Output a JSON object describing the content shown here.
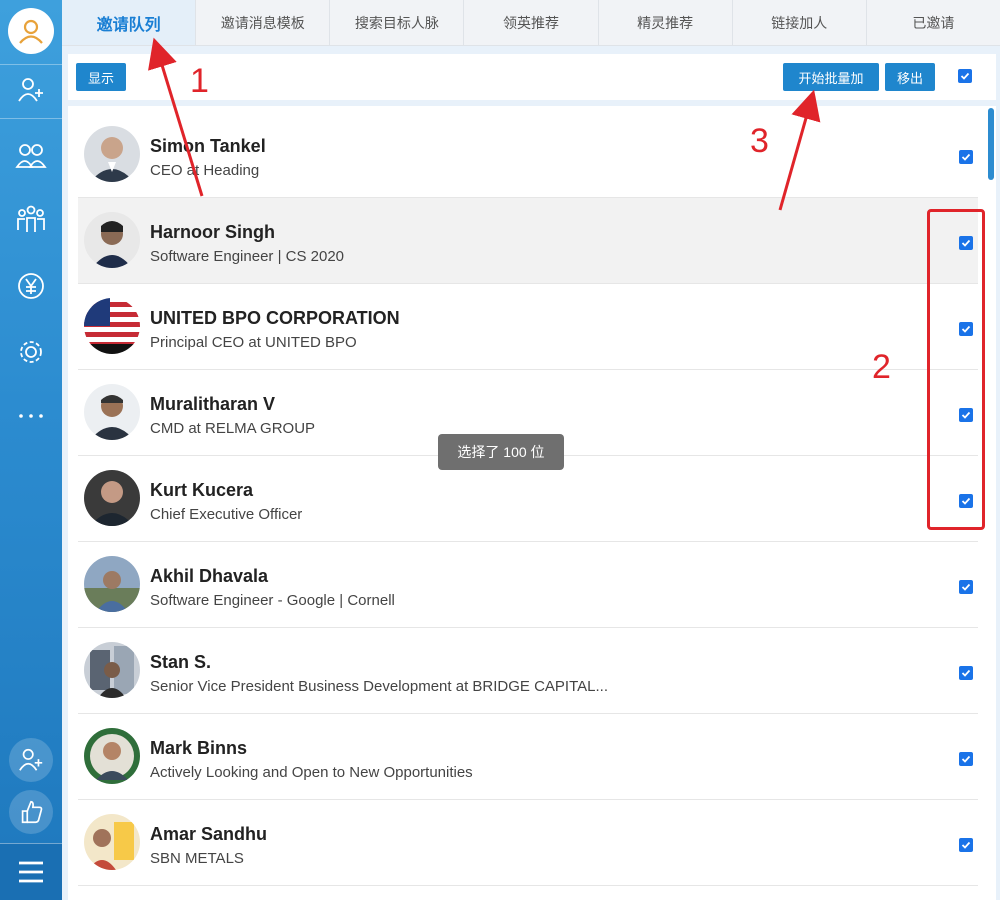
{
  "tabs": [
    "邀请队列",
    "邀请消息模板",
    "搜索目标人脉",
    "领英推荐",
    "精灵推荐",
    "链接加人",
    "已邀请"
  ],
  "active_tab": 0,
  "toolbar": {
    "show_label": "显示",
    "start_batch_label": "开始批量加",
    "remove_label": "移出",
    "select_all_checked": true
  },
  "toast": "选择了 100 位",
  "people": [
    {
      "name": "Simon Tankel",
      "headline": "CEO at Heading",
      "checked": true
    },
    {
      "name": "Harnoor Singh",
      "headline": "Software Engineer | CS 2020",
      "checked": true
    },
    {
      "name": "UNITED BPO CORPORATION",
      "headline": "Principal CEO at UNITED BPO",
      "checked": true
    },
    {
      "name": "Muralitharan V",
      "headline": "CMD at RELMA GROUP",
      "checked": true
    },
    {
      "name": "Kurt Kucera",
      "headline": "Chief Executive Officer",
      "checked": true
    },
    {
      "name": "Akhil Dhavala",
      "headline": "Software Engineer - Google | Cornell",
      "checked": true
    },
    {
      "name": "Stan S.",
      "headline": "Senior Vice President Business Development at BRIDGE CAPITAL...",
      "checked": true
    },
    {
      "name": "Mark Binns",
      "headline": "Actively Looking and Open to New Opportunities",
      "checked": true
    },
    {
      "name": "Amar Sandhu",
      "headline": "SBN METALS",
      "checked": true
    }
  ],
  "annotations": [
    "1",
    "2",
    "3"
  ],
  "colors": {
    "accent": "#1f86cd",
    "annotation": "#e0242a",
    "checkbox": "#1a73e8"
  }
}
